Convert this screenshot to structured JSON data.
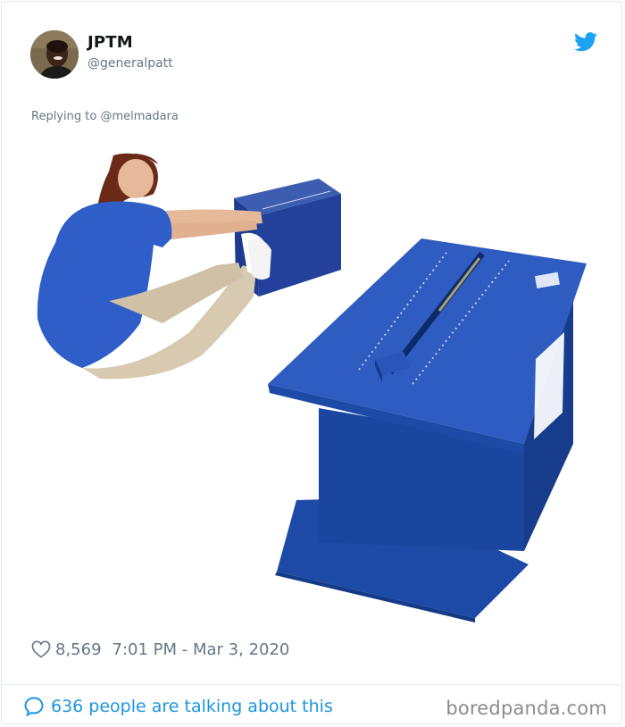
{
  "tweet": {
    "author_name": "JPTM",
    "author_handle": "@generalpatt",
    "replying_prefix": "Replying to",
    "replying_to": "@melmadara",
    "likes": "8,569",
    "timestamp": "7:01 PM - Mar 3, 2020",
    "talking": "636 people are talking about this"
  },
  "brand": {
    "twitter_color": "#1da1f2",
    "link_color": "#1b95e0",
    "muted_text": "#657786"
  },
  "icons": {
    "platform": "twitter-bird-icon",
    "like": "heart-icon",
    "reply": "speech-bubble-icon"
  },
  "watermark": "boredpanda.com"
}
